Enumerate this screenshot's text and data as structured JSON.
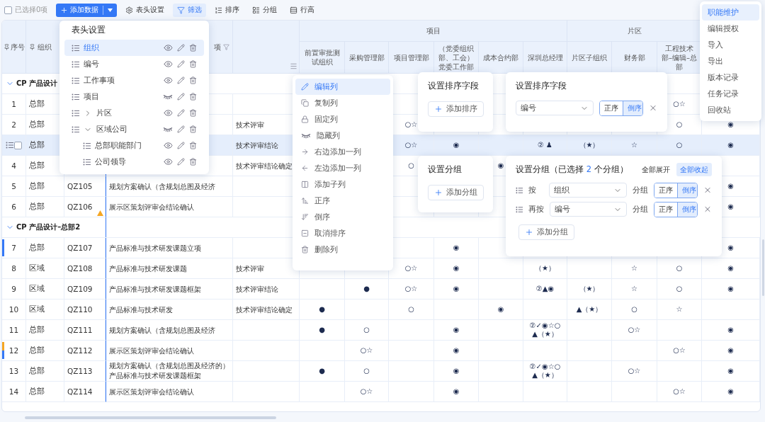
{
  "toolbar": {
    "select_all": {
      "label": "已选择0项",
      "checked": false
    },
    "add_button": {
      "label": "添加数据"
    },
    "tools": [
      {
        "kind": "settings",
        "label": "表头设置",
        "selected": false
      },
      {
        "kind": "filter",
        "label": "筛选",
        "selected": true
      },
      {
        "kind": "sort",
        "label": "排序",
        "selected": false
      },
      {
        "kind": "group",
        "label": "分组",
        "selected": false
      },
      {
        "kind": "height",
        "label": "行高",
        "selected": false
      }
    ]
  },
  "table": {
    "header": {
      "seq": {
        "label": "序号",
        "pinned": true
      },
      "org": {
        "label": "组织",
        "pinned": true
      },
      "task": {
        "label": "项",
        "filtered": true
      },
      "review": {
        "menu": true
      }
    },
    "groups": [
      {
        "label": "项目",
        "columns": [
          "前置审批测试组织",
          "采购管理部",
          "项目管理部",
          "（党委组织部、工会）党委工作部",
          "成本合约部",
          "深圳总经理"
        ]
      },
      {
        "label": "片区",
        "columns": [
          "片区子组织",
          "财务部",
          "工程技术部–编辑–总部"
        ]
      }
    ],
    "sections": [
      {
        "title": "CP 产品设计",
        "expanded": true,
        "rows": [
          {
            "seq": "1",
            "org": "总部",
            "selected": false,
            "warning": false,
            "cells": [
              null,
              null,
              null,
              null,
              null,
              null,
              null,
              null,
              "○☆",
              null
            ]
          },
          {
            "seq": "2",
            "org": "总部",
            "review": "技术评审",
            "selected": false,
            "warning": false,
            "cells": [
              null,
              null,
              "○☆",
              null,
              null,
              null,
              null,
              null,
              "○",
              "◉"
            ]
          },
          {
            "org": "总部",
            "review": "技术评审结论",
            "selected": true,
            "checked": false,
            "warning": false,
            "cells": [
              null,
              null,
              "○☆",
              "◉",
              null,
              "② ♟",
              "（★）",
              "☆",
              "○",
              "◉"
            ]
          },
          {
            "seq": "4",
            "org": "总部",
            "review": "技术评审结论确定",
            "selected": false,
            "warning": false,
            "cells": [
              null,
              null,
              "○",
              null,
              "◉",
              null,
              null,
              null,
              null,
              null
            ]
          },
          {
            "seq": "5",
            "org": "总部",
            "code": "QZ105",
            "task": "规划方案确认（含规划总图及经济",
            "selected": false,
            "warning": false,
            "cells": [
              null,
              null,
              null,
              null,
              null,
              null,
              null,
              null,
              null,
              "◉"
            ]
          },
          {
            "seq": "6",
            "org": "总部",
            "code": "QZ106",
            "task": "展示区策划评审会结论确认",
            "selected": false,
            "warning": true,
            "cells": [
              null,
              null,
              null,
              null,
              null,
              null,
              null,
              null,
              null,
              "◉"
            ]
          }
        ]
      },
      {
        "title": "CP 产品设计–总部2",
        "expanded": true,
        "rows": [
          {
            "seq": "7",
            "org": "总部",
            "code": "QZ107",
            "task": "产品标准与技术研发课题立项",
            "selected": false,
            "warning": false,
            "flags": [
              {
                "color": "#3478f6"
              }
            ],
            "cells": [
              null,
              null,
              null,
              "◉",
              null,
              null,
              null,
              null,
              null,
              "◉"
            ]
          },
          {
            "seq": "8",
            "org": "区域",
            "code": "QZ108",
            "task": "产品标准与技术研发课题",
            "review": "技术评审",
            "selected": false,
            "warning": false,
            "cells": [
              null,
              null,
              "○☆",
              "◉",
              null,
              "（★）",
              null,
              "☆",
              "○",
              "◉"
            ]
          },
          {
            "seq": "9",
            "org": "区域",
            "code": "QZ109",
            "task": "产品标准与技术研发课题框架",
            "review": "技术评审结论",
            "selected": false,
            "warning": false,
            "cells": [
              null,
              "●",
              "○☆",
              "◉",
              null,
              "②▲◉",
              "（★）",
              "☆",
              "○",
              "◉"
            ]
          },
          {
            "seq": "10",
            "org": "区域",
            "code": "QZ110",
            "task": "产品标准与技术研发",
            "review": "技术评审结论确定",
            "selected": false,
            "warning": false,
            "cells": [
              "●",
              null,
              "○",
              null,
              "◉",
              null,
              "▲（★）",
              "○",
              "☆",
              null
            ]
          },
          {
            "seq": "11",
            "org": "总部",
            "code": "QZ111",
            "task": "规划方案确认（含规划总图及经济",
            "selected": false,
            "warning": false,
            "cells": [
              "●",
              "○",
              null,
              "◉",
              null,
              [
                "②✓◉☆○",
                "▲（★）"
              ],
              null,
              "○☆",
              null,
              "◉"
            ]
          },
          {
            "seq": "12",
            "org": "总部",
            "code": "QZ112",
            "task": "展示区策划评审会结论确认",
            "selected": false,
            "warning": false,
            "flags": [
              {
                "color": "#f5a623"
              },
              {
                "color": "#3478f6"
              }
            ],
            "cells": [
              null,
              "○☆",
              null,
              "◉",
              null,
              null,
              null,
              null,
              "○☆",
              "◉"
            ]
          },
          {
            "seq": "13",
            "org": "总部",
            "code": "QZ113",
            "task": "规划方案确认（含规划总图及经济的）",
            "task_more": "产品标准与技术研发课题框架",
            "selected": false,
            "warning": false,
            "cells": [
              "●",
              "○",
              null,
              "◉",
              null,
              [
                "②✓◉☆○",
                "▲（★）"
              ],
              null,
              "○☆",
              null,
              "◉"
            ]
          },
          {
            "seq": "14",
            "org": "总部",
            "code": "QZ114",
            "task": "展示区策划评审会结论确认",
            "selected": false,
            "warning": false,
            "cells": [
              null,
              "○☆",
              null,
              "◉",
              null,
              null,
              null,
              null,
              "○☆",
              "◉"
            ]
          }
        ]
      }
    ]
  },
  "column_settings": {
    "title": "表头设置",
    "items": [
      {
        "label": "组织",
        "selected": true,
        "visible": true
      },
      {
        "label": "编号",
        "selected": false,
        "visible": true
      },
      {
        "label": "工作事项",
        "selected": false,
        "visible": true
      },
      {
        "label": "项目",
        "selected": false,
        "visible": false
      },
      {
        "label": "片区",
        "selected": false,
        "visible": true,
        "expanded": false
      },
      {
        "label": "区域公司",
        "selected": false,
        "visible": false,
        "expanded": true,
        "children": [
          {
            "label": "总部职能部门",
            "selected": false,
            "visible": true
          },
          {
            "label": "公司领导",
            "selected": false,
            "visible": true
          }
        ]
      }
    ]
  },
  "column_menu": {
    "items": [
      {
        "label": "编辑列",
        "selected": true
      },
      {
        "label": "复制列",
        "selected": false
      },
      {
        "label": "固定列",
        "selected": false
      },
      {
        "label": "隐藏列",
        "selected": false
      },
      {
        "label": "右边添加一列",
        "selected": false
      },
      {
        "label": "左边添加一列",
        "selected": false
      },
      {
        "label": "添加子列",
        "selected": false
      },
      {
        "label": "正序",
        "selected": false
      },
      {
        "label": "倒序",
        "selected": false
      },
      {
        "label": "取消排序",
        "selected": false
      },
      {
        "label": "删除列",
        "selected": false
      }
    ]
  },
  "sort_empty": {
    "title": "设置排序字段",
    "add_label": "添加排序"
  },
  "sort_popup": {
    "title": "设置排序字段",
    "rules": [
      {
        "field": "编号",
        "orders": [
          {
            "label": "正序",
            "selected": false
          },
          {
            "label": "倒序",
            "selected": true
          }
        ]
      }
    ]
  },
  "group_empty": {
    "title": "设置分组",
    "add_label": "添加分组"
  },
  "group_popup": {
    "title": "设置分组（已选择",
    "count": "2",
    "title_end": "个分组）",
    "actions": [
      {
        "label": "全部展开",
        "selected": false
      },
      {
        "label": "全部收起",
        "selected": true
      }
    ],
    "rules": [
      {
        "prefix": "按",
        "field": "组织",
        "suffix": "分组",
        "orders": [
          {
            "label": "正序",
            "selected": false
          },
          {
            "label": "倒序",
            "selected": true
          }
        ]
      },
      {
        "prefix": "再按",
        "field": "编号",
        "suffix": "分组",
        "orders": [
          {
            "label": "正序",
            "selected": false
          },
          {
            "label": "倒序",
            "selected": true
          }
        ]
      }
    ],
    "add_label": "添加分组"
  },
  "more_menu": {
    "items": [
      {
        "label": "职能维护",
        "selected": true
      },
      {
        "label": "编辑授权",
        "selected": false
      },
      {
        "label": "导入",
        "selected": false
      },
      {
        "label": "导出",
        "selected": false
      },
      {
        "label": "版本记录",
        "selected": false
      },
      {
        "label": "任务记录",
        "selected": false
      },
      {
        "label": "回收站",
        "selected": false
      }
    ]
  }
}
